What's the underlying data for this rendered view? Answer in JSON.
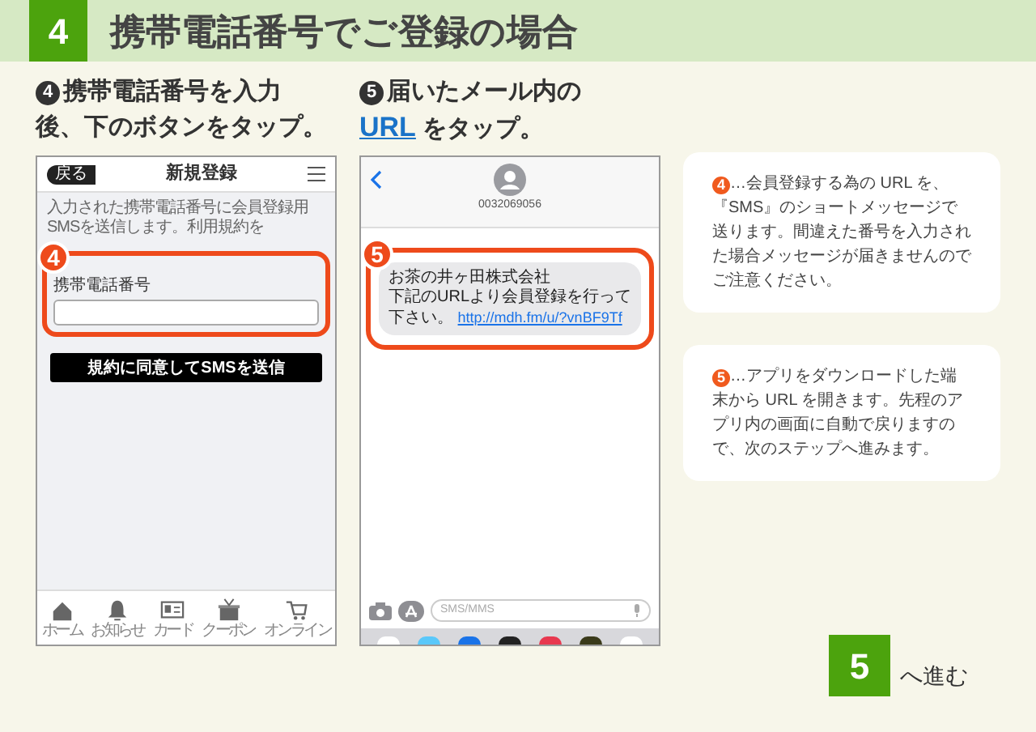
{
  "header": {
    "step": "4",
    "title": "携帯電話番号でご登録の場合"
  },
  "steps": [
    {
      "number": "4",
      "lines": [
        "携帯電話番号を入力",
        "後、下のボタンをタップ。"
      ]
    },
    {
      "number": "5",
      "text": "届いたメール内の",
      "link": "URL",
      "text_after": " をタップ。"
    }
  ],
  "phone_form": {
    "back": "戻る",
    "title": "新規登録",
    "intro": "入力された携帯電話番号に会員登録用SMSを送信します。利用規約を",
    "callout": "4",
    "field_label": "携帯電話番号",
    "submit": "規約に同意してSMSを送信",
    "tabs": [
      {
        "label": "ホーム"
      },
      {
        "label": "お知らせ"
      },
      {
        "label": "カード"
      },
      {
        "label": "クーポン"
      },
      {
        "label": "オンライン"
      }
    ]
  },
  "phone_sms": {
    "sender": "0032069056",
    "callout": "5",
    "message": [
      "お茶の井ヶ田株式会社",
      "下記のURLより会員登録を行って下さい。"
    ],
    "link": "http://mdh.fm/u/?vnBF9Tf",
    "input_placeholder": "SMS/MMS"
  },
  "notes": [
    {
      "number": "4",
      "text": "…会員登録する為の URL を、『SMS』のショートメッセージで送ります。間違えた番号を入力された場合メッセージが届きませんのでご注意ください。"
    },
    {
      "number": "5",
      "text": "…アプリをダウンロードした端末から URL を開きます。先程のアプリ内の画面に自動で戻りますので、次のステップへ進みます。"
    }
  ],
  "next": {
    "step": "5",
    "label": "へ進む"
  }
}
